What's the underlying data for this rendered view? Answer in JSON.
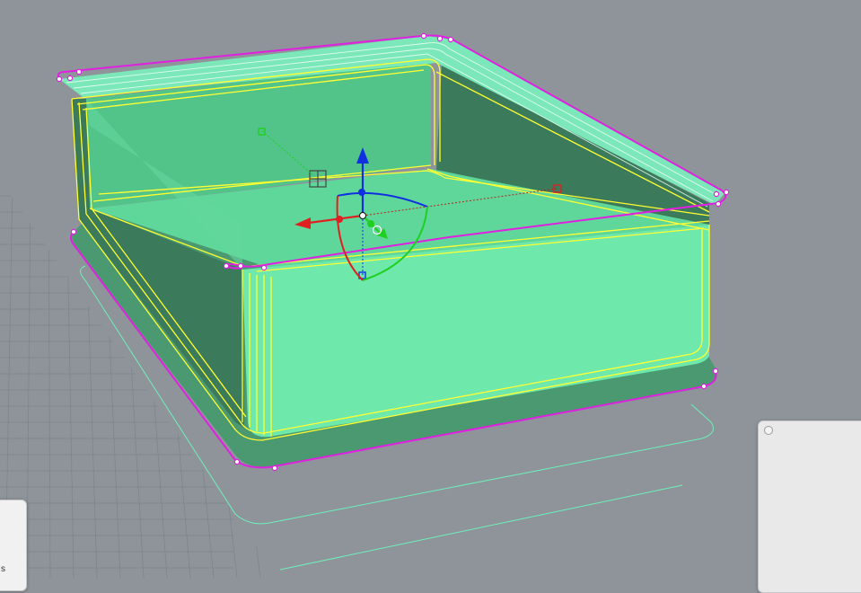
{
  "viewport": {
    "background": "#8e949a",
    "object": "box-solid-selected",
    "colors": {
      "selection_outline": "#e020e0",
      "highlight_edges": "#ffff33",
      "solid_fill": "#6ee8ab",
      "dark_face": "#3b7a5a",
      "shadow_fill": "#2f8a5a",
      "gumball_x": "#ff2020",
      "gumball_y": "#20d020",
      "gumball_z": "#1030e0"
    },
    "icons": [
      "gumball-widget-icon",
      "move-grip-icon"
    ]
  },
  "left_panel": {
    "fragment_text": "s"
  },
  "right_panel": {}
}
